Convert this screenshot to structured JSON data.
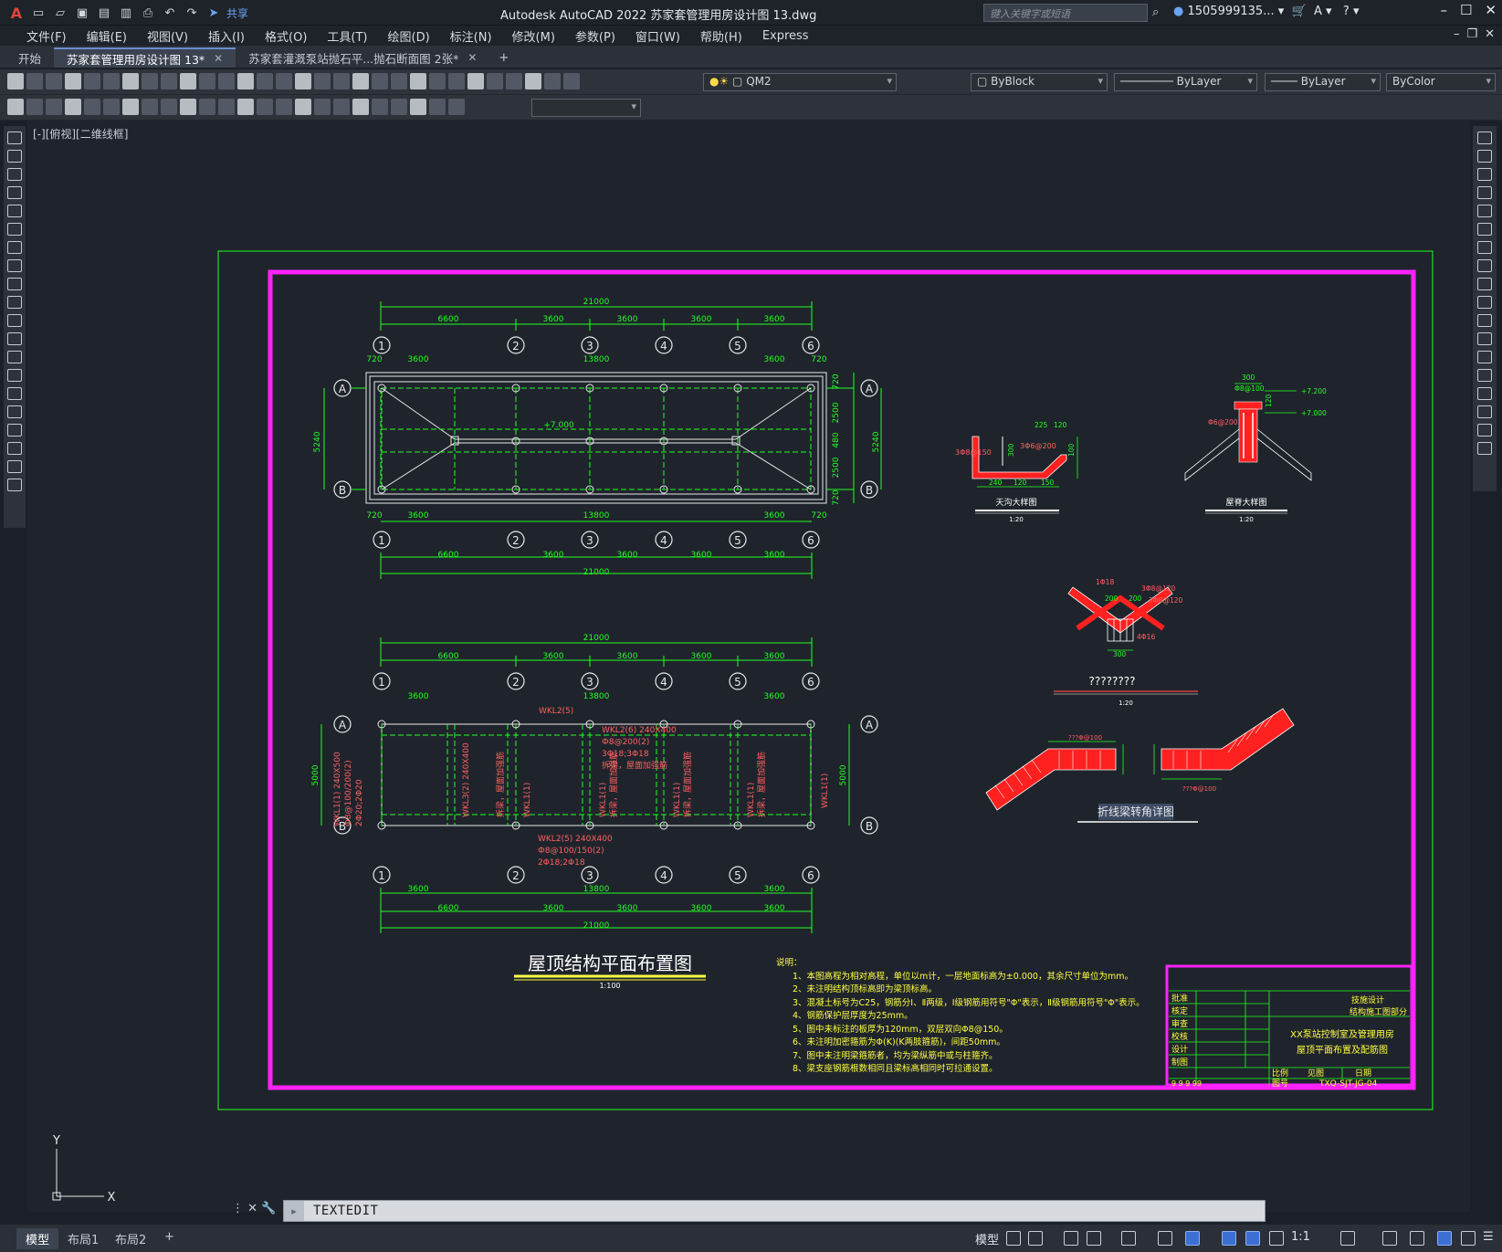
{
  "app": {
    "title": "Autodesk AutoCAD 2022    苏家套管理用房设计图 13.dwg",
    "share_label": "共享",
    "search_placeholder": "键入关键字或短语",
    "user": "1505999135...",
    "menu": [
      "文件(F)",
      "编辑(E)",
      "视图(V)",
      "插入(I)",
      "格式(O)",
      "工具(T)",
      "绘图(D)",
      "标注(N)",
      "修改(M)",
      "参数(P)",
      "窗口(W)",
      "帮助(H)",
      "Express"
    ]
  },
  "tabs": [
    {
      "label": "开始",
      "active": false,
      "closable": false
    },
    {
      "label": "苏家套管理用房设计图 13*",
      "active": true,
      "closable": true
    },
    {
      "label": "苏家套灌溉泵站抛石平...抛石断面图 2张*",
      "active": false,
      "closable": true
    }
  ],
  "toolbar": {
    "layer": "QM2",
    "color": "ByBlock",
    "linetype": "ByLayer",
    "lineweight": "ByLayer",
    "plotstyle": "ByColor"
  },
  "view_label": "[-][俯视][二维线框]",
  "drawing": {
    "title": "屋顶结构平面布置图",
    "title_scale": "1:100",
    "grid_cols": [
      "1",
      "2",
      "3",
      "4",
      "5",
      "6"
    ],
    "grid_rows": [
      "A",
      "B"
    ],
    "overall_dim": "21000",
    "top_dims": [
      "6600",
      "3600",
      "3600",
      "3600",
      "3600"
    ],
    "inner_dims": [
      "720",
      "3600",
      "13800",
      "3600",
      "720"
    ],
    "lower_inner_dims": [
      "3600",
      "13800",
      "3600"
    ],
    "height_left": "5240",
    "height_right_segments": [
      "720",
      "2500",
      "480",
      "2500",
      "720"
    ],
    "ridge_elev": "+7.000",
    "beam_height": "5000",
    "beam_labels": {
      "wkl2_5_top": "WKL2(5)",
      "wkl2_6": "WKL2(6) 240X400",
      "wkl2_6_a": "Ф8@200(2)",
      "wkl2_6_b": "3Φ18;3Φ18",
      "wkl2_6_c": "拆梁，屋面加强筋",
      "wkl2_5_bot": "WKL2(5) 240X400",
      "wkl2_5_bot_a": "Ф8@100/150(2)",
      "wkl2_5_bot_b": "2Φ18;2Φ18",
      "wkl1_left": "WKL1(1) 240X500",
      "wkl1_left_a": "Ф8@100/200(2)",
      "wkl1_left_b": "2Φ20;2Φ20",
      "wkl3": "WKL3(2) 240X400",
      "wkl1_v": "WKL1(1)",
      "wkl1_v_note": "拆梁，屋面加强筋"
    },
    "detail1_title": "天沟大样图",
    "detail1_scale": "1:20",
    "detail2_title": "屋脊大样图",
    "detail2_scale": "1:20",
    "detail3_title": "????????",
    "detail3_scale": "1:20",
    "detail4_title": "折线梁转角详图",
    "d1_labels": {
      "a": "3Φ8@150",
      "b": "3Φ6@200",
      "c": "225",
      "d": "120",
      "e": "300",
      "f": "240",
      "g": "120",
      "h": "150",
      "i": "100"
    },
    "d2_labels": {
      "a": "300",
      "b": "Φ8@100",
      "c": "Φ6@200",
      "d": "+7.200",
      "e": "+7.000",
      "f": "120",
      "g": "120"
    },
    "d3_labels": {
      "a": "1Φ18",
      "b": "3Φ8@120",
      "c": "3Φ8@120",
      "d": "4Φ16",
      "e": "300",
      "f": "200",
      "g": "200"
    },
    "d4_labels": {
      "a": "???Φ@100",
      "b": "???Φ@100"
    },
    "notes_title": "说明：",
    "notes": [
      "1、本图高程为相对高程，单位以m计，一层地面标高为±0.000，其余尺寸单位为mm。",
      "2、未注明结构顶标高即为梁顶标高。",
      "3、混凝土标号为C25，钢筋分Ⅰ、Ⅱ两级，Ⅰ级钢筋用符号\"Φ\"表示，Ⅱ级钢筋用符号\"Φ\"表示。",
      "4、钢筋保护层厚度为25mm。",
      "5、图中未标注的板厚为120mm，双层双向Φ8@150。",
      "6、未注明加密箍筋为Φ(K)(K两肢箍筋)，间距50mm。",
      "7、图中未注明梁箍筋者，均为梁纵筋中或与柱箍齐。",
      "8、梁支座钢筋根数相同且梁标高相同时可拉通设置。"
    ],
    "titleblock": {
      "rows": [
        "批准",
        "核定",
        "审查",
        "校核",
        "设计",
        "制图"
      ],
      "org": "技施设计",
      "dept": "结构施工图部分",
      "name_line1": "XX泵站控制室及管理用房",
      "name_line2": "屋顶平面布置及配筋图",
      "scale_label": "比例",
      "scale_value": "见图",
      "date_label": "日期",
      "drawing_no_label": "图号",
      "drawing_no": "TXQ-SJT-JG-04",
      "code": "9 9 9 99"
    }
  },
  "command": {
    "text": "TEXTEDIT"
  },
  "layout_tabs": [
    "模型",
    "布局1",
    "布局2"
  ],
  "status": {
    "model": "模型",
    "scale": "1:1"
  },
  "ucs": {
    "x": "X",
    "y": "Y"
  },
  "colors": {
    "frame": "#ff22ff",
    "green": "#22ff22",
    "red": "#ff2020",
    "yellow": "#ffff40",
    "white": "#e8e8e8"
  }
}
